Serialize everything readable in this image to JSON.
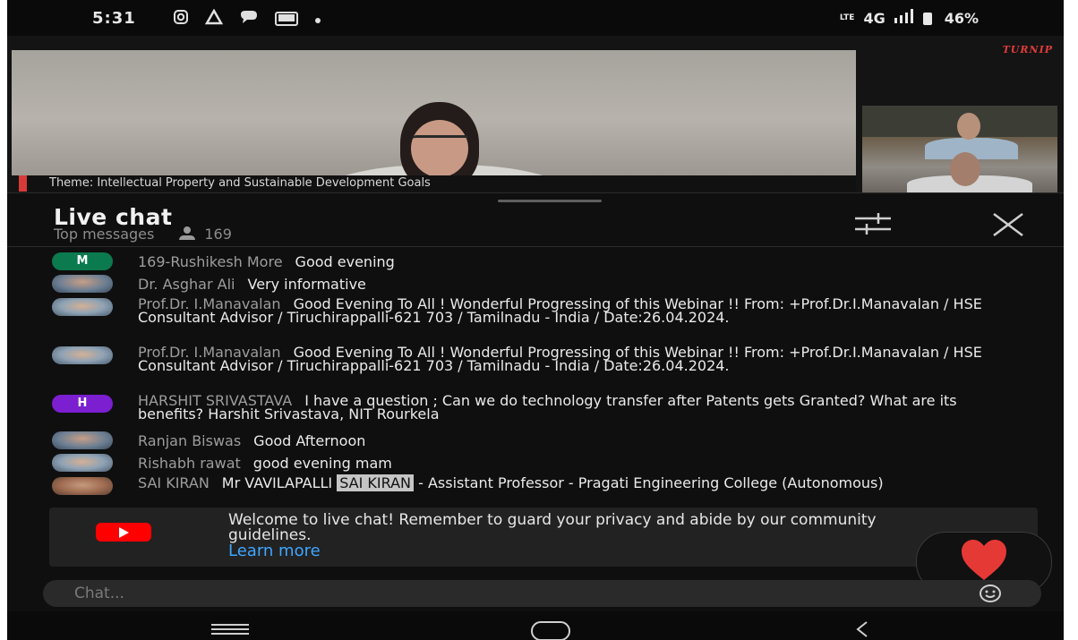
{
  "status_bar": {
    "time": "5:31",
    "network": "4G",
    "volte": "LTE",
    "battery": "46%"
  },
  "video": {
    "brand": "TURNIP",
    "caption": "Theme: Intellectual Property and Sustainable Development Goals"
  },
  "live_chat": {
    "title": "Live chat",
    "subtitle": "Top messages",
    "viewer_count": "169",
    "messages": [
      {
        "author": "169-Rushikesh More",
        "text": "Good evening",
        "avatar": "M"
      },
      {
        "author": "Dr. Asghar Ali",
        "text": "Very informative",
        "avatar": ""
      },
      {
        "author": "Prof.Dr. I.Manavalan",
        "text": "Good Evening To All ! Wonderful Progressing of this Webinar !! From: +Prof.Dr.I.Manavalan / HSE Consultant Advisor / Tiruchirappalli-621 703 / Tamilnadu - India / Date:26.04.2024.",
        "avatar": ""
      },
      {
        "author": "Prof.Dr. I.Manavalan",
        "text": "Good Evening To All ! Wonderful Progressing of this Webinar !! From: +Prof.Dr.I.Manavalan / HSE Consultant Advisor / Tiruchirappalli-621 703 / Tamilnadu - India / Date:26.04.2024.",
        "avatar": ""
      },
      {
        "author": "HARSHIT SRIVASTAVA",
        "text": "I have a question ; Can we do technology transfer after Patents gets Granted? What are its benefits? Harshit Srivastava, NIT Rourkela",
        "avatar": "H"
      },
      {
        "author": "Ranjan Biswas",
        "text": "Good Afternoon",
        "avatar": ""
      },
      {
        "author": "Rishabh rawat",
        "text": "good evening mam",
        "avatar": ""
      },
      {
        "author": "SAI KIRAN",
        "text_before": "Mr VAVILAPALLI",
        "highlight": "SAI KIRAN",
        "text_after": "- Assistant Professor - Pragati Engineering College (Autonomous)",
        "avatar": ""
      }
    ]
  },
  "welcome": {
    "text": "Welcome to live chat! Remember to guard your privacy and abide by our community guidelines.",
    "link": "Learn more"
  },
  "chat_input": {
    "placeholder": "Chat..."
  },
  "colors": {
    "background": "#0f0f0f",
    "accent_link": "#3ea6ff",
    "youtube_red": "#ff0000",
    "heart": "#e53935",
    "avatar_m": "#0b7a4e",
    "avatar_h": "#7b1fd1"
  },
  "icons": {
    "status": [
      "instagram-icon",
      "drive-icon",
      "chat-bubble-icon",
      "notification-badge-icon",
      "dot-icon"
    ],
    "filter": "tune-icon",
    "close": "close-icon",
    "reaction": "heart-icon",
    "emoji": "smiley-icon",
    "nav": [
      "recents-icon",
      "home-icon",
      "back-icon"
    ]
  }
}
